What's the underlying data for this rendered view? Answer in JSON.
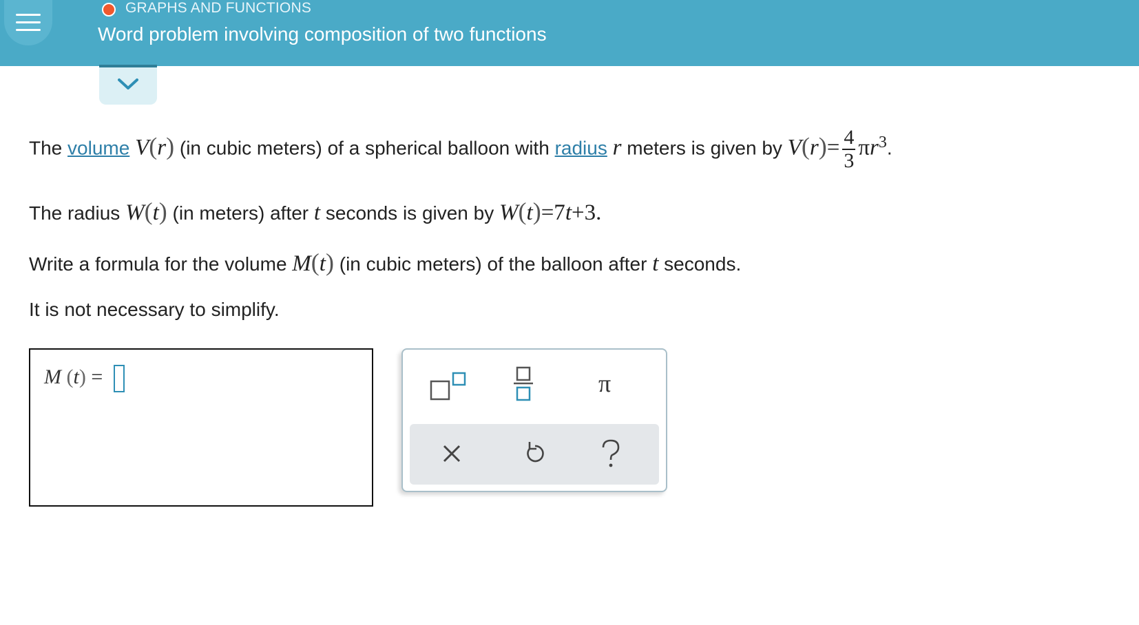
{
  "header": {
    "topic": "GRAPHS AND FUNCTIONS",
    "title": "Word problem involving composition of two functions"
  },
  "problem": {
    "line1": {
      "the": "The",
      "volume_link": "volume",
      "v_name": "V",
      "v_arg": "r",
      "text_a": "(in cubic meters) of a spherical balloon with",
      "radius_link": "radius",
      "r_var": "r",
      "text_b": "meters is given by",
      "v_name2": "V",
      "v_arg2": "r",
      "equals": "=",
      "frac_num": "4",
      "frac_den": "3",
      "pi": "π",
      "r_var2": "r",
      "exp": "3",
      "period": "."
    },
    "line2": {
      "text_a": "The radius",
      "w_name": "W",
      "w_arg": "t",
      "text_b": "(in meters) after",
      "t_var": "t",
      "text_c": "seconds is given by",
      "w_name2": "W",
      "w_arg2": "t",
      "rhs_a": "=7",
      "rhs_t": "t",
      "rhs_b": "+3."
    },
    "line3": {
      "text_a": "Write a formula for the volume",
      "m_name": "M",
      "m_arg": "t",
      "text_b": "(in cubic meters) of the balloon after",
      "t_var": "t",
      "text_c": "seconds."
    },
    "line4": "It is not necessary to simplify."
  },
  "answer": {
    "m_name": "M",
    "m_arg": "t",
    "equals": "="
  },
  "keypad": {
    "pi": "π",
    "icons": [
      "superscript-icon",
      "fraction-icon",
      "pi-icon",
      "clear-icon",
      "undo-icon",
      "help-icon"
    ]
  },
  "colors": {
    "header": "#4aaac7",
    "topic_dot": "#f0582d",
    "link": "#2e7fa8",
    "tab_border": "#2f7e97"
  }
}
